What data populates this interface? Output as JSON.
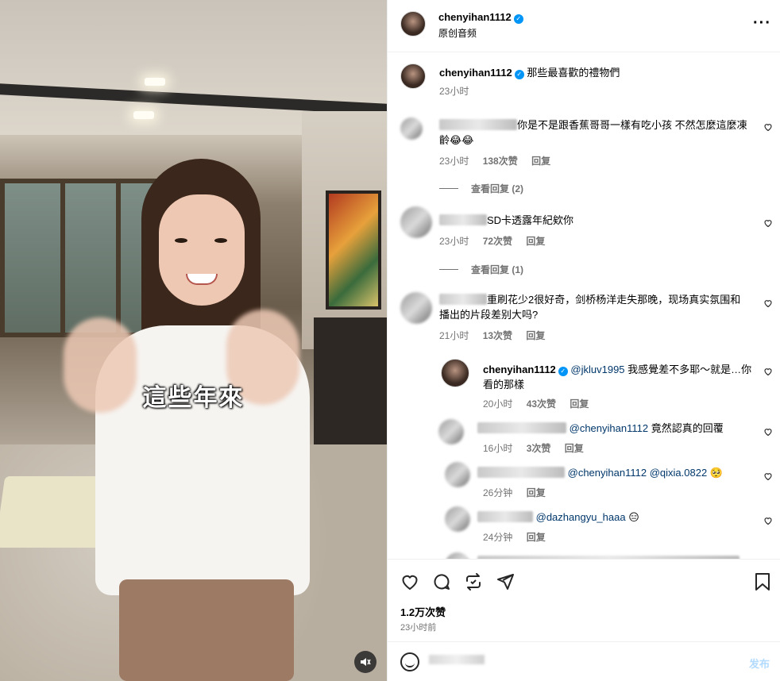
{
  "media": {
    "caption_overlay": "這些年來",
    "mute_icon": "speaker-muted-icon"
  },
  "post": {
    "author": "chenyihan1112",
    "audio_label": "原创音频",
    "more_icon": "more-options-icon"
  },
  "caption": {
    "author": "chenyihan1112",
    "text": "那些最喜歡的禮物們",
    "time": "23小时"
  },
  "comments": [
    {
      "text": "你是不是跟香蕉哥哥一樣有吃小孩 不然怎麼這麼凍齡😂😂",
      "time": "23小时",
      "likes": "138次赞",
      "reply_label": "回复",
      "view_replies": "查看回复 (2)"
    },
    {
      "text": "SD卡透露年紀欸你",
      "time": "23小时",
      "likes": "72次赞",
      "reply_label": "回复",
      "view_replies": "查看回复 (1)"
    },
    {
      "text": "重刷花少2很好奇，剑桥杨洋走失那晚，现场真实氛围和播出的片段差别大吗?",
      "time": "21小时",
      "likes": "13次赞",
      "reply_label": "回复"
    }
  ],
  "replies": [
    {
      "author": "chenyihan1112",
      "mention": "@jkluv1995",
      "text": " 我感覺差不多耶～就是…你看的那樣",
      "time": "20小时",
      "likes": "43次赞",
      "reply_label": "回复"
    },
    {
      "mention": "@chenyihan1112",
      "text": " 竟然認真的回覆",
      "time": "16小时",
      "likes": "3次赞",
      "reply_label": "回复"
    },
    {
      "mention": "@chenyihan1112",
      "mention2": "@qixia.0822",
      "text": " 🥺",
      "time": "26分钟",
      "reply_label": "回复"
    },
    {
      "mention": "@dazhangyu_haaa",
      "text": " 😑",
      "time": "24分钟",
      "reply_label": "回复"
    }
  ],
  "actions": {
    "like_icon": "heart-icon",
    "comment_icon": "comment-icon",
    "repost_icon": "repost-icon",
    "share_icon": "share-icon",
    "save_icon": "bookmark-icon",
    "likes": "1.2万次赞",
    "time_ago": "23小时前"
  },
  "composer": {
    "emoji_icon": "emoji-icon",
    "post_label": "发布"
  },
  "colors": {
    "verified": "#0095f6",
    "mention": "#00376b",
    "muted_text": "#737373",
    "post_button_disabled": "#b3dbff"
  }
}
